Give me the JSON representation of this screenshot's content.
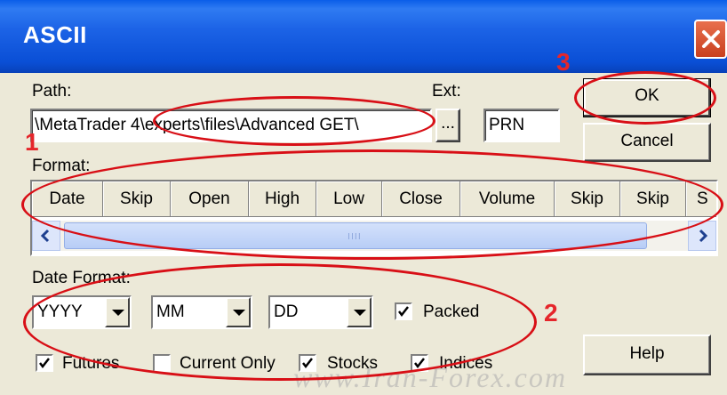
{
  "window": {
    "title": "ASCII"
  },
  "path": {
    "label": "Path:",
    "value": "\\MetaTrader 4\\experts\\files\\Advanced GET\\",
    "browse_label": "..."
  },
  "ext": {
    "label": "Ext:",
    "value": "PRN"
  },
  "buttons": {
    "ok": "OK",
    "cancel": "Cancel",
    "help": "Help"
  },
  "format": {
    "label": "Format:",
    "columns": [
      "Date",
      "Skip",
      "Open",
      "High",
      "Low",
      "Close",
      "Volume",
      "Skip",
      "Skip",
      "S"
    ],
    "scroll_grip": "IIII"
  },
  "date_format": {
    "label": "Date Format:",
    "year": "YYYY",
    "month": "MM",
    "day": "DD"
  },
  "checkboxes": {
    "packed": {
      "label": "Packed",
      "checked": true
    },
    "futures": {
      "label": "Futures",
      "checked": true
    },
    "current_only": {
      "label": "Current Only",
      "checked": false
    },
    "stocks": {
      "label": "Stocks",
      "checked": true
    },
    "indices": {
      "label": "Indices",
      "checked": true
    }
  },
  "annotations": {
    "one": "1",
    "two": "2",
    "three": "3",
    "color": "#d80f16"
  },
  "watermark": "www.Iran-Forex.com",
  "colors": {
    "titlebar": "#0a4fd6",
    "dialog_bg": "#ece9d8",
    "close_button": "#d9542f"
  }
}
